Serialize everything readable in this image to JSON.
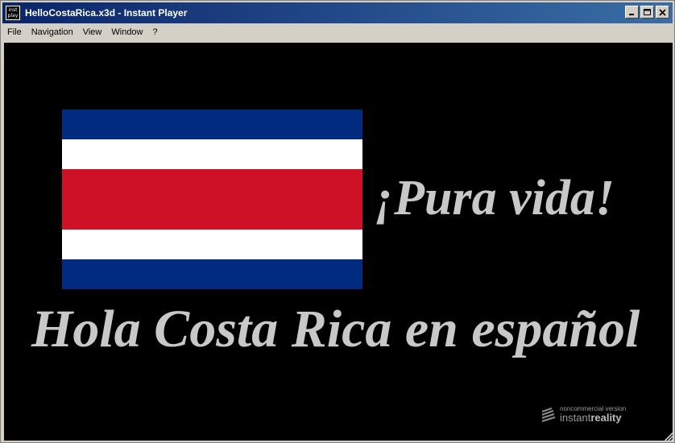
{
  "window": {
    "title": "HelloCostaRica.x3d - Instant Player",
    "icon_label_top": "inst",
    "icon_label_bottom": "play",
    "icon": "app-icon",
    "controls": [
      "minimize-icon",
      "maximize-icon",
      "close-icon"
    ]
  },
  "menu": {
    "items": [
      "File",
      "Navigation",
      "View",
      "Window",
      "?"
    ]
  },
  "scene": {
    "background": "#000000",
    "flag": {
      "name": "costa-rica-flag",
      "stripe_colors": [
        "#002b7f",
        "#ffffff",
        "#ce1126",
        "#ffffff",
        "#002b7f"
      ],
      "stripe_ratios": [
        1,
        1,
        2,
        1,
        1
      ]
    },
    "slogan": "¡Pura vida!",
    "headline": "Hola Costa Rica en español",
    "text_color": "#c8c8c8"
  },
  "watermark": {
    "small": "noncommercial version",
    "brand_light": "instant",
    "brand_bold": "reality"
  }
}
